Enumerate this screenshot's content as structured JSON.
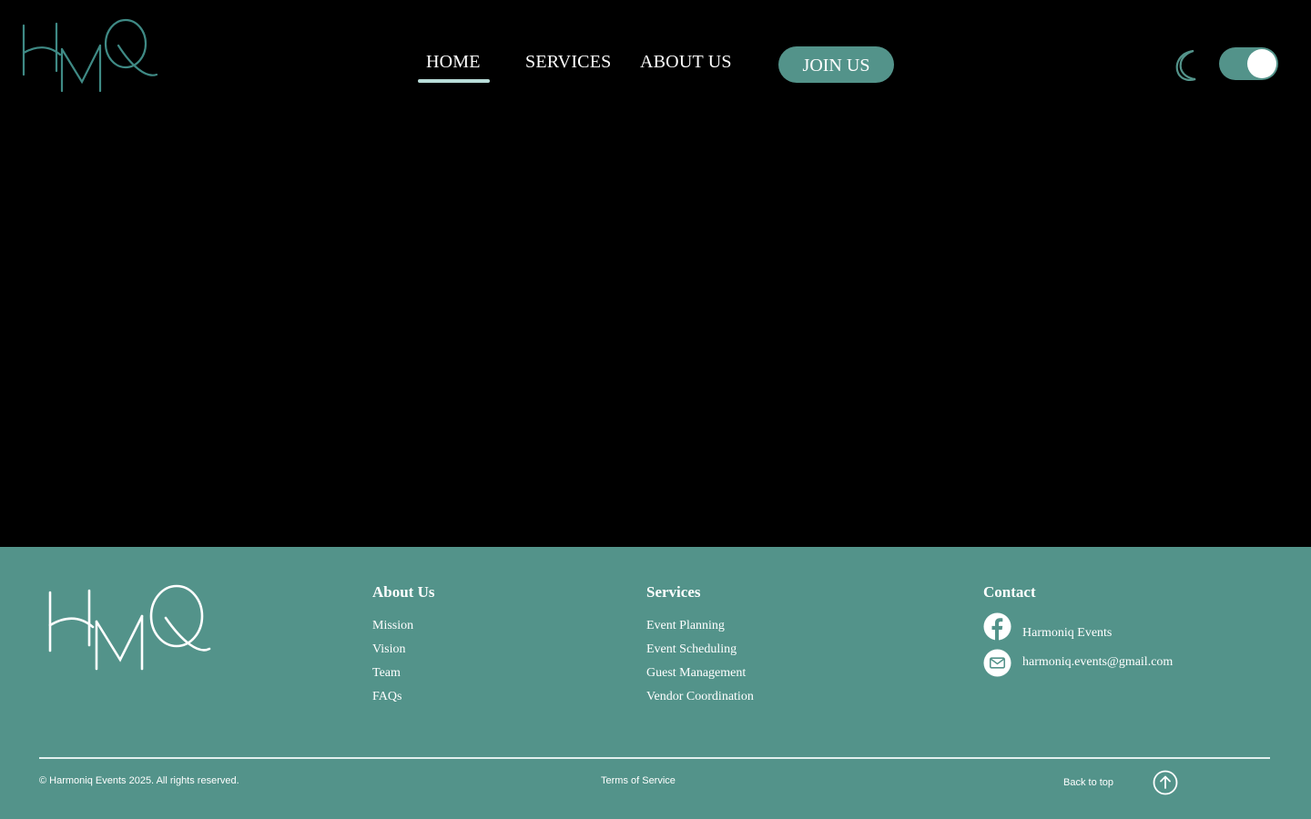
{
  "header": {
    "logo_text": "HMQ",
    "nav": {
      "home": "HOME",
      "services": "SERVICES",
      "about": "ABOUT US",
      "active": "HOME"
    },
    "join_label": "JOIN US",
    "theme_icon": "moon-icon",
    "theme_toggle_on": true
  },
  "footer": {
    "logo_text": "HMQ",
    "about": {
      "title": "About Us",
      "items": [
        "Mission",
        "Vision",
        "Team",
        "FAQs"
      ]
    },
    "services": {
      "title": "Services",
      "items": [
        "Event Planning",
        "Event Scheduling",
        "Guest Management",
        "Vendor Coordination"
      ]
    },
    "contact": {
      "title": "Contact",
      "facebook": "Harmoniq Events",
      "email": "harmoniq.events@gmail.com",
      "facebook_icon": "facebook-icon",
      "email_icon": "mail-icon"
    },
    "copyright": "© Harmoniq Events 2025. All rights reserved.",
    "terms": "Terms of Service",
    "back_to_top": "Back to top",
    "back_to_top_icon": "arrow-up-circle-icon"
  },
  "colors": {
    "background": "#000000",
    "accent": "#53938a",
    "nav_underline": "#b8dcd8",
    "text": "#ffffff"
  }
}
